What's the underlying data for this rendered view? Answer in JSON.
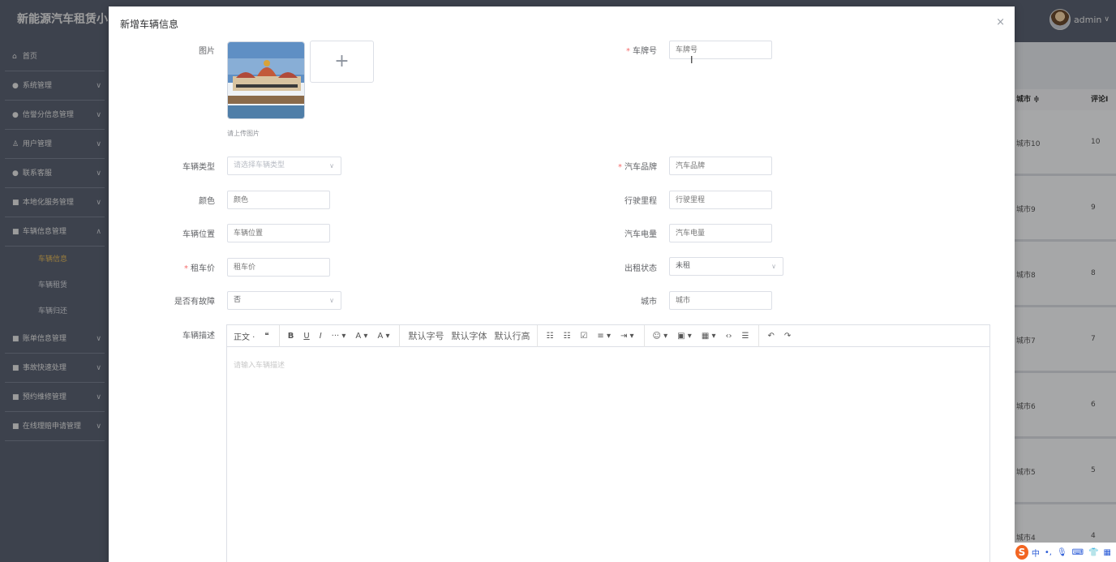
{
  "app": {
    "logo": "新能源汽车租赁小",
    "user": "admin",
    "menu": [
      {
        "icon": "⌂",
        "label": "首页",
        "chev": ""
      },
      {
        "icon": "●",
        "label": "系统管理",
        "chev": "∨"
      },
      {
        "icon": "●",
        "label": "信誉分信息管理",
        "chev": "∨"
      },
      {
        "icon": "♙",
        "label": "用户管理",
        "chev": "∨"
      },
      {
        "icon": "●",
        "label": "联系客服",
        "chev": "∨"
      },
      {
        "icon": "■",
        "label": "本地化服务管理",
        "chev": "∨"
      },
      {
        "icon": "■",
        "label": "车辆信息管理",
        "chev": "∧"
      }
    ],
    "submenu": [
      "车辆信息",
      "车辆租赁",
      "车辆归还"
    ],
    "menu2": [
      {
        "icon": "■",
        "label": "账单信息管理",
        "chev": "∨"
      },
      {
        "icon": "■",
        "label": "事故快速处理",
        "chev": "∨"
      },
      {
        "icon": "■",
        "label": "预约维修管理",
        "chev": "∨"
      },
      {
        "icon": "■",
        "label": "在线理赔申请管理",
        "chev": "∨"
      }
    ],
    "table": {
      "col_city": "城市 ≑",
      "col_comments": "评论I",
      "rows": [
        {
          "city": "城市10",
          "n": "10"
        },
        {
          "city": "城市9",
          "n": "9"
        },
        {
          "city": "城市8",
          "n": "8"
        },
        {
          "city": "城市7",
          "n": "7"
        },
        {
          "city": "城市6",
          "n": "6"
        },
        {
          "city": "城市5",
          "n": "5"
        },
        {
          "city": "城市4",
          "n": "4"
        }
      ]
    }
  },
  "dialog": {
    "title": "新增车辆信息",
    "close": "×",
    "image_label": "图片",
    "upload_hint": "请上传图片",
    "upload_plus": "+",
    "plate_label": "车牌号",
    "plate_placeholder": "车牌号",
    "type_label": "车辆类型",
    "type_placeholder": "请选择车辆类型",
    "brand_label": "汽车品牌",
    "brand_placeholder": "汽车品牌",
    "color_label": "颜色",
    "color_placeholder": "颜色",
    "mileage_label": "行驶里程",
    "mileage_placeholder": "行驶里程",
    "location_label": "车辆位置",
    "location_placeholder": "车辆位置",
    "battery_label": "汽车电量",
    "battery_placeholder": "汽车电量",
    "price_label": "租车价",
    "price_placeholder": "租车价",
    "rent_status_label": "出租状态",
    "rent_status_value": "未租",
    "fault_label": "是否有故障",
    "fault_value": "否",
    "city_label": "城市",
    "city_placeholder": "城市",
    "desc_label": "车辆描述",
    "desc_placeholder": "请输入车辆描述",
    "toolbar": {
      "heading": "正文 ·",
      "quote": "❝",
      "bold": "B",
      "underline": "U",
      "italic": "I",
      "more": "··· ▾",
      "font_color": "A ▾",
      "bg_color": "A ▾",
      "font_size": "默认字号",
      "font_family": "默认字体",
      "line_height": "默认行高",
      "bullet": "☷",
      "numbered": "☷",
      "todo": "☑",
      "align": "≡ ▾",
      "indent": "⇥ ▾",
      "emoji": "☺ ▾",
      "image": "▣ ▾",
      "table": "▦ ▾",
      "code": "‹›",
      "divider": "☰",
      "undo": "↶",
      "redo": "↷"
    },
    "required_mark": "*"
  },
  "tray": {
    "s": "S",
    "lang": "中",
    "punct": "•,",
    "mic": "🎙",
    "kbd": "⌨",
    "shirt": "👕",
    "grid": "▦"
  }
}
